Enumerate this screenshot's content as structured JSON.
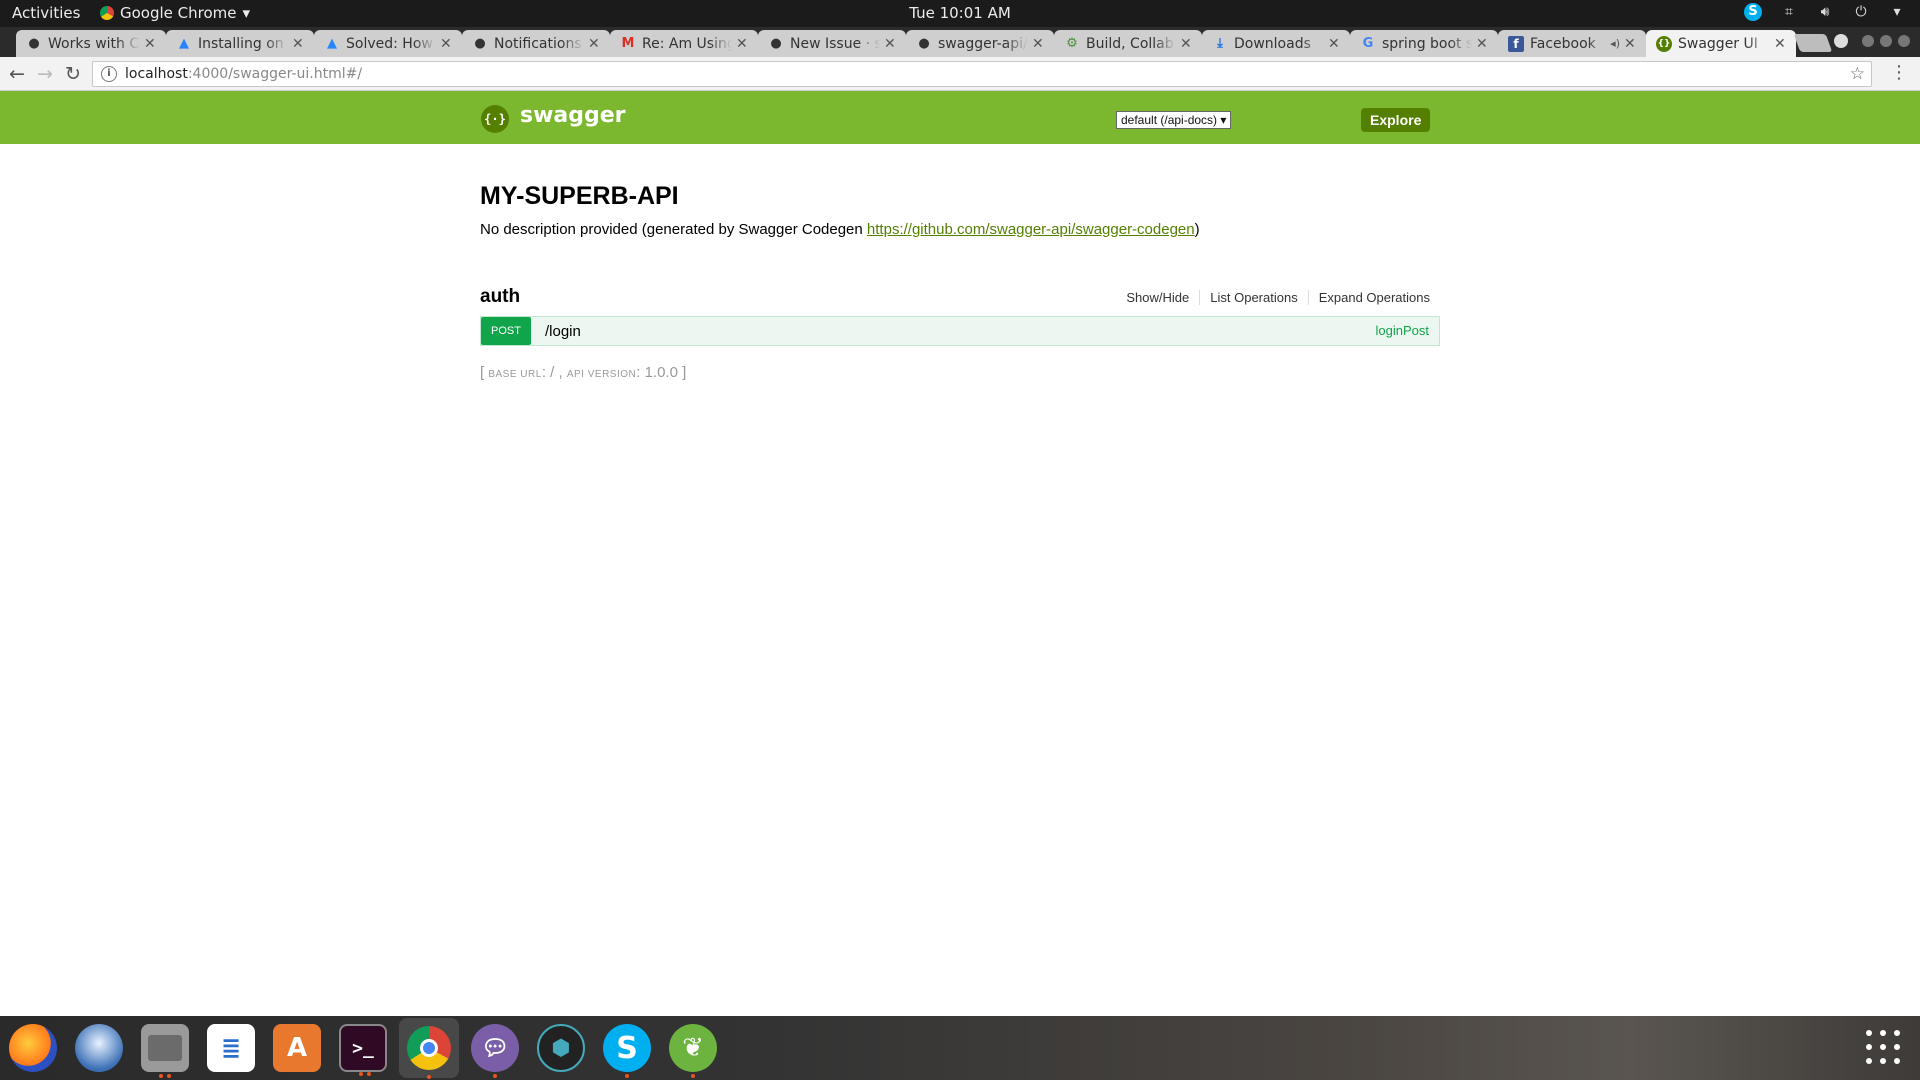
{
  "system": {
    "activities": "Activities",
    "app_menu": "Google Chrome",
    "clock": "Tue 10:01 AM"
  },
  "tabs": [
    {
      "title": "Works with C",
      "icon": "github-icon"
    },
    {
      "title": "Installing on",
      "icon": "atlassian-icon"
    },
    {
      "title": "Solved: How",
      "icon": "atlassian-icon"
    },
    {
      "title": "Notifications",
      "icon": "github-icon"
    },
    {
      "title": "Re: Am Using",
      "icon": "gmail-icon"
    },
    {
      "title": "New Issue · s",
      "icon": "github-icon"
    },
    {
      "title": "swagger-api/",
      "icon": "github-icon"
    },
    {
      "title": "Build, Collab",
      "icon": "build-icon"
    },
    {
      "title": "Downloads",
      "icon": "download-icon"
    },
    {
      "title": "spring boot s",
      "icon": "google-icon"
    },
    {
      "title": "Facebook",
      "icon": "facebook-icon"
    },
    {
      "title": "Swagger UI",
      "icon": "swagger-icon",
      "active": true
    }
  ],
  "address": {
    "host": "localhost",
    "path": ":4000/swagger-ui.html#/"
  },
  "swagger": {
    "brand": "swagger",
    "spec_select": "default (/api-docs) ▾",
    "explore_label": "Explore"
  },
  "api": {
    "title": "MY-SUPERB-API",
    "description_prefix": "No description provided (generated by Swagger Codegen ",
    "description_link": "https://github.com/swagger-api/swagger-codegen",
    "description_suffix": ")"
  },
  "resource": {
    "name": "auth",
    "actions": [
      "Show/Hide",
      "List Operations",
      "Expand Operations"
    ],
    "operations": [
      {
        "method": "POST",
        "path": "/login",
        "nickname": "loginPost"
      }
    ]
  },
  "footer": {
    "open": "[ ",
    "base_url_label": "base url",
    "base_url_value": ": / , ",
    "api_version_label": "api version",
    "api_version_value": ": 1.0.0 ]"
  },
  "colors": {
    "swagger_green": "#7cb82f",
    "swagger_dark": "#547f00",
    "post_green": "#10a54a"
  }
}
